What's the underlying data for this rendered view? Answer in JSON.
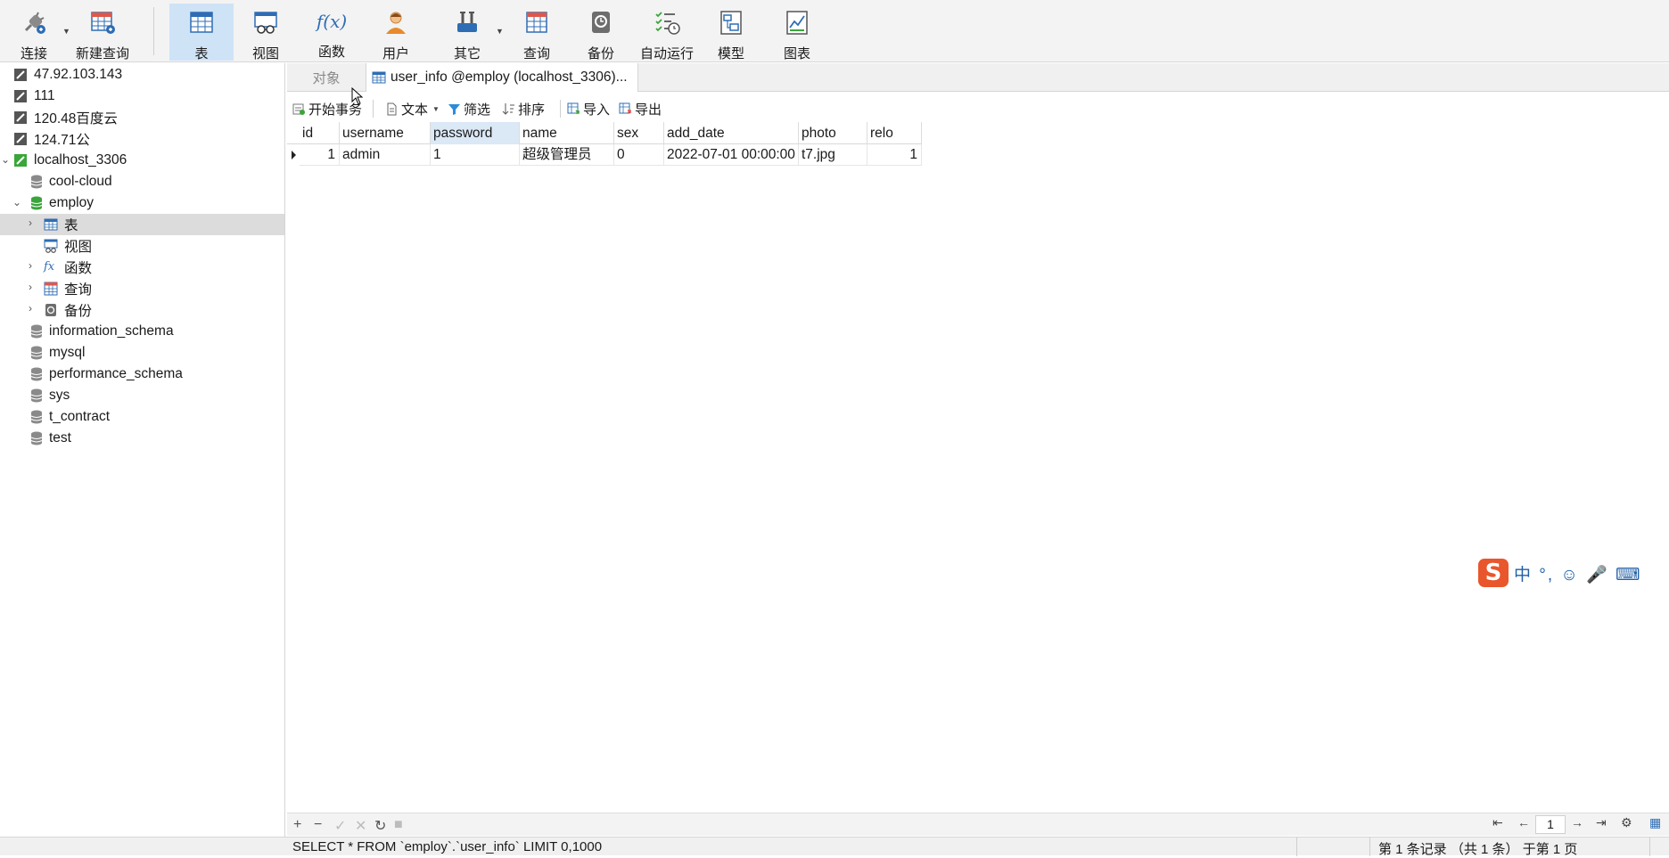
{
  "toolbar": {
    "buttons": [
      {
        "label": "连接",
        "icon": "plug-icon"
      },
      {
        "label": "新建查询",
        "icon": "new-query-icon"
      },
      {
        "label": "表",
        "icon": "table-icon"
      },
      {
        "label": "视图",
        "icon": "view-icon"
      },
      {
        "label": "函数",
        "icon": "function-icon",
        "glyph": "f(x)"
      },
      {
        "label": "用户",
        "icon": "user-icon"
      },
      {
        "label": "其它",
        "icon": "tools-icon"
      },
      {
        "label": "查询",
        "icon": "query-icon"
      },
      {
        "label": "备份",
        "icon": "backup-icon"
      },
      {
        "label": "自动运行",
        "icon": "schedule-icon"
      },
      {
        "label": "模型",
        "icon": "model-icon"
      },
      {
        "label": "图表",
        "icon": "chart-icon"
      }
    ],
    "active": "表"
  },
  "sidebar": {
    "connections": [
      "47.92.103.143",
      "111",
      "120.48百度云",
      "124.71公"
    ],
    "local": "localhost_3306",
    "databases_before": [
      "cool-cloud"
    ],
    "open_db": "employ",
    "employ_children": [
      "表",
      "视图",
      "函数",
      "查询",
      "备份"
    ],
    "databases_after": [
      "information_schema",
      "mysql",
      "performance_schema",
      "sys",
      "t_contract",
      "test"
    ]
  },
  "tabs": {
    "objects": "对象",
    "active": "user_info @employ (localhost_3306)..."
  },
  "subtoolbar": {
    "begin_transaction": "开始事务",
    "text": "文本",
    "filter": "筛选",
    "sort": "排序",
    "import": "导入",
    "export": "导出"
  },
  "table": {
    "columns": [
      "id",
      "username",
      "password",
      "name",
      "sex",
      "add_date",
      "photo",
      "relo"
    ],
    "rows": [
      [
        "1",
        "admin",
        "1",
        "超级管理员",
        "0",
        "2022-07-01 00:00:00",
        "t7.jpg",
        "1"
      ]
    ]
  },
  "ime": {
    "logo": "S",
    "text": "中 °, ☺ 🎤 ⌨"
  },
  "pager": {
    "page": "1"
  },
  "status": {
    "sql": "SELECT * FROM `employ`.`user_info` LIMIT 0,1000",
    "records": "第 1 条记录 （共 1 条） 于第 1 页"
  },
  "colors": {
    "active_tab": "#cfe3f6",
    "selected_tree": "#dcdcdc",
    "db_green": "#3aa53a",
    "icon_blue": "#2e6db4"
  }
}
